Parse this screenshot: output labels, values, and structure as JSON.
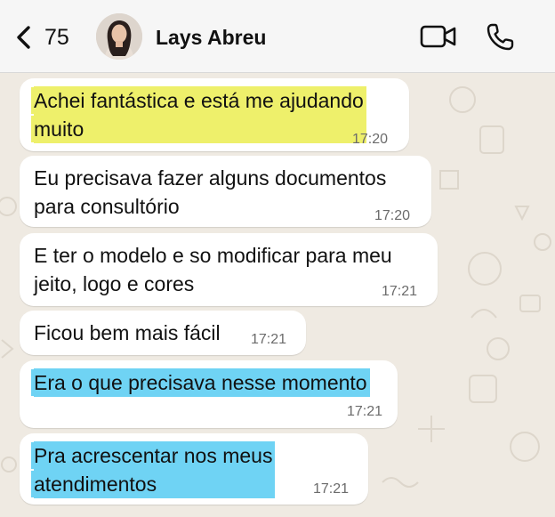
{
  "header": {
    "unread_count": "75",
    "contact_name": "Lays Abreu"
  },
  "icons": {
    "back": "chevron-left-icon",
    "video": "video-camera-icon",
    "phone": "phone-icon"
  },
  "colors": {
    "highlight_yellow": "#eef06b",
    "highlight_blue": "#6fd3f4",
    "bubble": "#ffffff",
    "chat_background": "#efeae2"
  },
  "messages": [
    {
      "lines": [
        "Achei fantástica e está me ajudando",
        "muito"
      ],
      "time": "17:20",
      "highlight": "yellow"
    },
    {
      "lines": [
        "Eu precisava fazer alguns documentos",
        "para consultório"
      ],
      "time": "17:20",
      "highlight": "none"
    },
    {
      "lines": [
        "E ter o modelo e so modificar para meu",
        "jeito, logo e cores"
      ],
      "time": "17:21",
      "highlight": "none"
    },
    {
      "lines": [
        "Ficou bem mais fácil"
      ],
      "time": "17:21",
      "highlight": "none"
    },
    {
      "lines": [
        "Era o que precisava nesse momento"
      ],
      "time": "17:21",
      "highlight": "blue"
    },
    {
      "lines": [
        "Pra acrescentar nos meus",
        "atendimentos"
      ],
      "time": "17:21",
      "highlight": "blue"
    }
  ]
}
